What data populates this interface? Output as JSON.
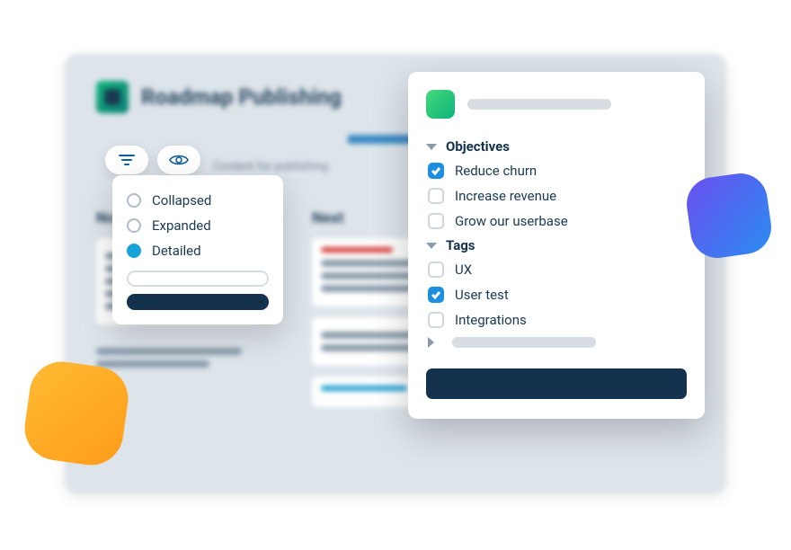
{
  "background": {
    "title": "Roadmap Publishing",
    "hint_text": "Content for publishing",
    "columns": [
      {
        "title": "Now"
      },
      {
        "title": "Next"
      }
    ]
  },
  "view_menu": {
    "options": [
      {
        "label": "Collapsed",
        "selected": false
      },
      {
        "label": "Expanded",
        "selected": false
      },
      {
        "label": "Detailed",
        "selected": true
      }
    ]
  },
  "filter_panel": {
    "sections": [
      {
        "title": "Objectives",
        "expanded": true,
        "items": [
          {
            "label": "Reduce churn",
            "checked": true
          },
          {
            "label": "Increase revenue",
            "checked": false
          },
          {
            "label": "Grow our userbase",
            "checked": false
          }
        ]
      },
      {
        "title": "Tags",
        "expanded": true,
        "items": [
          {
            "label": "UX",
            "checked": false
          },
          {
            "label": "User test",
            "checked": true
          },
          {
            "label": "Integrations",
            "checked": false
          }
        ]
      }
    ]
  }
}
